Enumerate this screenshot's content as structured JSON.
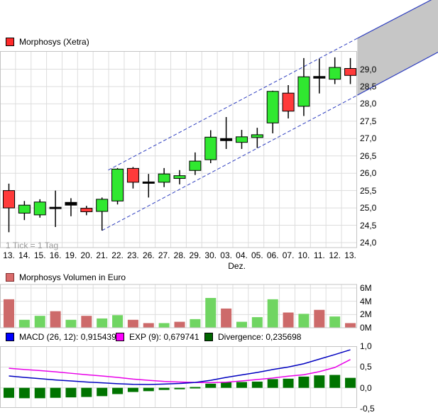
{
  "header_legend": {
    "label": "Morphosys (Xetra)",
    "marker_color": "#ff2a2a",
    "marker_border": "#000000"
  },
  "tick_note": "1 Tick = 1 Tag",
  "month_label": "Dez.",
  "volume_legend": {
    "label": "Morphosys Volumen in Euro",
    "marker_color": "#d96b6b",
    "marker_border": "#803030"
  },
  "macd_legend": {
    "macd": {
      "label": "MACD (26, 12): 0,915439",
      "marker_color": "#0000ff",
      "marker_border": "#000000"
    },
    "exp": {
      "label": "EXP (9): 0,679741",
      "marker_color": "#ff00ff",
      "marker_border": "#000000"
    },
    "divergence": {
      "label": "Divergence: 0,235698",
      "marker_color": "#006600",
      "marker_border": "#000000"
    }
  },
  "price_axis": {
    "labels": [
      "29,0",
      "28,5",
      "28,0",
      "27,5",
      "27,0",
      "26,5",
      "26,0",
      "25,5",
      "25,0",
      "24,5",
      "24,0"
    ],
    "values": [
      29.0,
      28.5,
      28.0,
      27.5,
      27.0,
      26.5,
      26.0,
      25.5,
      25.0,
      24.5,
      24.0
    ]
  },
  "volume_axis": {
    "labels": [
      "6M",
      "4M",
      "2M",
      "0M"
    ],
    "values": [
      6,
      4,
      2,
      0
    ]
  },
  "macd_axis": {
    "labels": [
      "1,0",
      "0,5",
      "0,0",
      "-0,5"
    ],
    "values": [
      1.0,
      0.5,
      0.0,
      -0.5
    ]
  },
  "chart_data": [
    {
      "type": "candlestick",
      "title": "Morphosys (Xetra)",
      "dates": [
        "13.",
        "14.",
        "15.",
        "16.",
        "19.",
        "20.",
        "21.",
        "22.",
        "23.",
        "26.",
        "27.",
        "28.",
        "29.",
        "30.",
        "03.",
        "04.",
        "05.",
        "06.",
        "07.",
        "10.",
        "11.",
        "12.",
        "13."
      ],
      "month_label_below_index": 14,
      "open": [
        25.5,
        24.85,
        24.8,
        24.98,
        25.08,
        24.99,
        24.9,
        25.2,
        26.14,
        25.71,
        25.74,
        25.85,
        26.08,
        26.39,
        26.94,
        26.89,
        27.03,
        27.45,
        28.31,
        27.93,
        28.74,
        28.71,
        29.02
      ],
      "high": [
        25.7,
        25.2,
        25.25,
        25.5,
        25.28,
        25.06,
        25.3,
        26.15,
        26.18,
        25.98,
        26.15,
        26.09,
        26.6,
        27.24,
        27.62,
        27.25,
        27.31,
        28.38,
        28.54,
        29.32,
        29.3,
        29.34,
        29.32
      ],
      "low": [
        24.3,
        24.65,
        24.72,
        24.45,
        24.76,
        24.79,
        24.35,
        25.1,
        25.56,
        25.3,
        25.6,
        25.68,
        25.95,
        26.29,
        26.7,
        26.7,
        26.73,
        27.15,
        27.58,
        27.65,
        28.3,
        28.57,
        28.57
      ],
      "close": [
        25.0,
        25.08,
        25.17,
        25.02,
        25.16,
        24.89,
        25.25,
        26.12,
        25.74,
        25.75,
        25.98,
        25.93,
        26.35,
        27.04,
        27.0,
        27.05,
        27.11,
        28.36,
        27.79,
        28.78,
        28.79,
        29.05,
        28.82
      ],
      "dir": [
        "down",
        "up",
        "up",
        "neutral",
        "neutral",
        "down",
        "up",
        "up",
        "down",
        "neutral",
        "up",
        "up",
        "up",
        "up",
        "neutral",
        "up",
        "up",
        "up",
        "down",
        "up",
        "neutral",
        "up",
        "down"
      ],
      "up_color": "#30e830",
      "down_color": "#ff3a3a",
      "neutral_color": "#000000",
      "wick_color": "#000000",
      "ylim": [
        24.0,
        29.5
      ],
      "trend_channel": {
        "color": "#3040c0",
        "upper": {
          "from_index": 6.4,
          "from_price": 26.09,
          "to_index": 22.45,
          "to_price": 29.89
        },
        "lower": {
          "from_index": 6.0,
          "from_price": 24.35,
          "to_index": 22.45,
          "to_price": 28.25
        },
        "extension": {
          "fill": "#c6c6c6",
          "upper_price_at_image_right": 31.1,
          "lower_price_at_image_right": 29.49
        }
      }
    },
    {
      "type": "bar",
      "title": "Morphosys Volumen in Euro",
      "values_millions": [
        4.3,
        1.2,
        1.8,
        2.5,
        1.2,
        1.8,
        1.4,
        1.9,
        1.2,
        0.7,
        0.7,
        0.9,
        1.3,
        4.5,
        2.9,
        0.9,
        1.6,
        4.3,
        2.3,
        2.1,
        2.7,
        1.7,
        0.7
      ],
      "dir": [
        "down",
        "up",
        "up",
        "down",
        "up",
        "down",
        "up",
        "up",
        "down",
        "down",
        "up",
        "down",
        "up",
        "up",
        "down",
        "up",
        "up",
        "up",
        "down",
        "up",
        "down",
        "up",
        "down"
      ],
      "up_color": "#70d562",
      "down_color": "#cd6a6a",
      "ylim": [
        0,
        6.5
      ]
    },
    {
      "type": "macd",
      "macd_line": [
        0.285,
        0.25,
        0.22,
        0.19,
        0.165,
        0.14,
        0.12,
        0.1,
        0.085,
        0.08,
        0.09,
        0.105,
        0.13,
        0.18,
        0.25,
        0.31,
        0.37,
        0.44,
        0.5,
        0.58,
        0.69,
        0.8,
        0.915
      ],
      "exp_line": [
        0.47,
        0.44,
        0.415,
        0.385,
        0.35,
        0.315,
        0.285,
        0.25,
        0.21,
        0.18,
        0.155,
        0.14,
        0.13,
        0.125,
        0.135,
        0.165,
        0.2,
        0.235,
        0.28,
        0.315,
        0.39,
        0.49,
        0.68
      ],
      "divergence": [
        -0.24,
        -0.25,
        -0.25,
        -0.24,
        -0.23,
        -0.22,
        -0.2,
        -0.15,
        -0.1,
        -0.08,
        -0.05,
        -0.02,
        0.02,
        0.1,
        0.14,
        0.14,
        0.15,
        0.21,
        0.22,
        0.27,
        0.3,
        0.31,
        0.24
      ],
      "macd_color": "#0000c0",
      "exp_color": "#e800e8",
      "divergence_color": "#007400",
      "ylim": [
        -0.5,
        1.0
      ]
    }
  ]
}
